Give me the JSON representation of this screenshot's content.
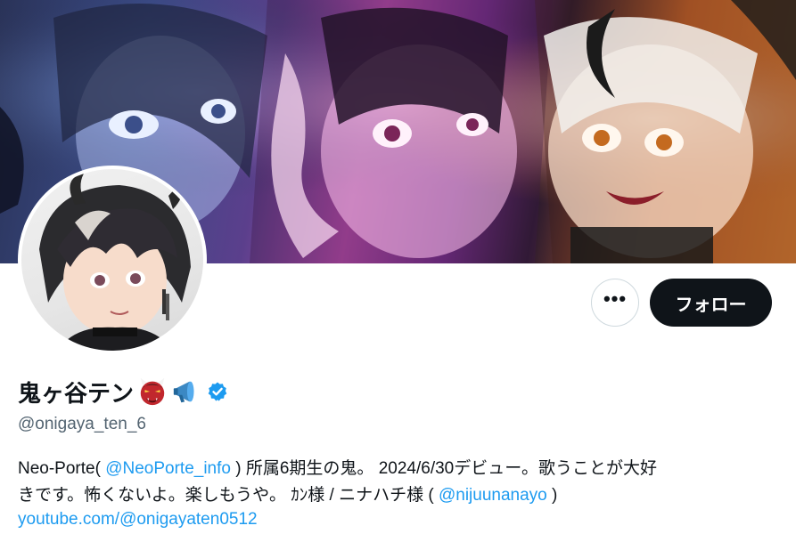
{
  "profile": {
    "display_name": "鬼ヶ谷テン",
    "emoji_1": "ogre-icon",
    "emoji_2": "megaphone-icon",
    "verified": "verified-badge-icon",
    "handle": "@onigaya_ten_6"
  },
  "actions": {
    "more_label": "•••",
    "follow_label": "フォロー"
  },
  "bio": {
    "line1_pre": "Neo-Porte(",
    "mention_1": "@NeoPorte_info",
    "line1_post": ") 所属6期生の鬼。 2024/6/30デビュー。歌うことが大好",
    "line2_pre": "きです。怖くないよ。楽しもうや。 ｶﾝ様 / ニナハチ様 (",
    "mention_2": "@nijuunanayo",
    "line2_post": ")",
    "site_link": "youtube.com/@onigayaten0512"
  },
  "colors": {
    "accent": "#1d9bf0",
    "text": "#0f1419",
    "muted": "#536471",
    "follow_bg": "#0f1419"
  }
}
